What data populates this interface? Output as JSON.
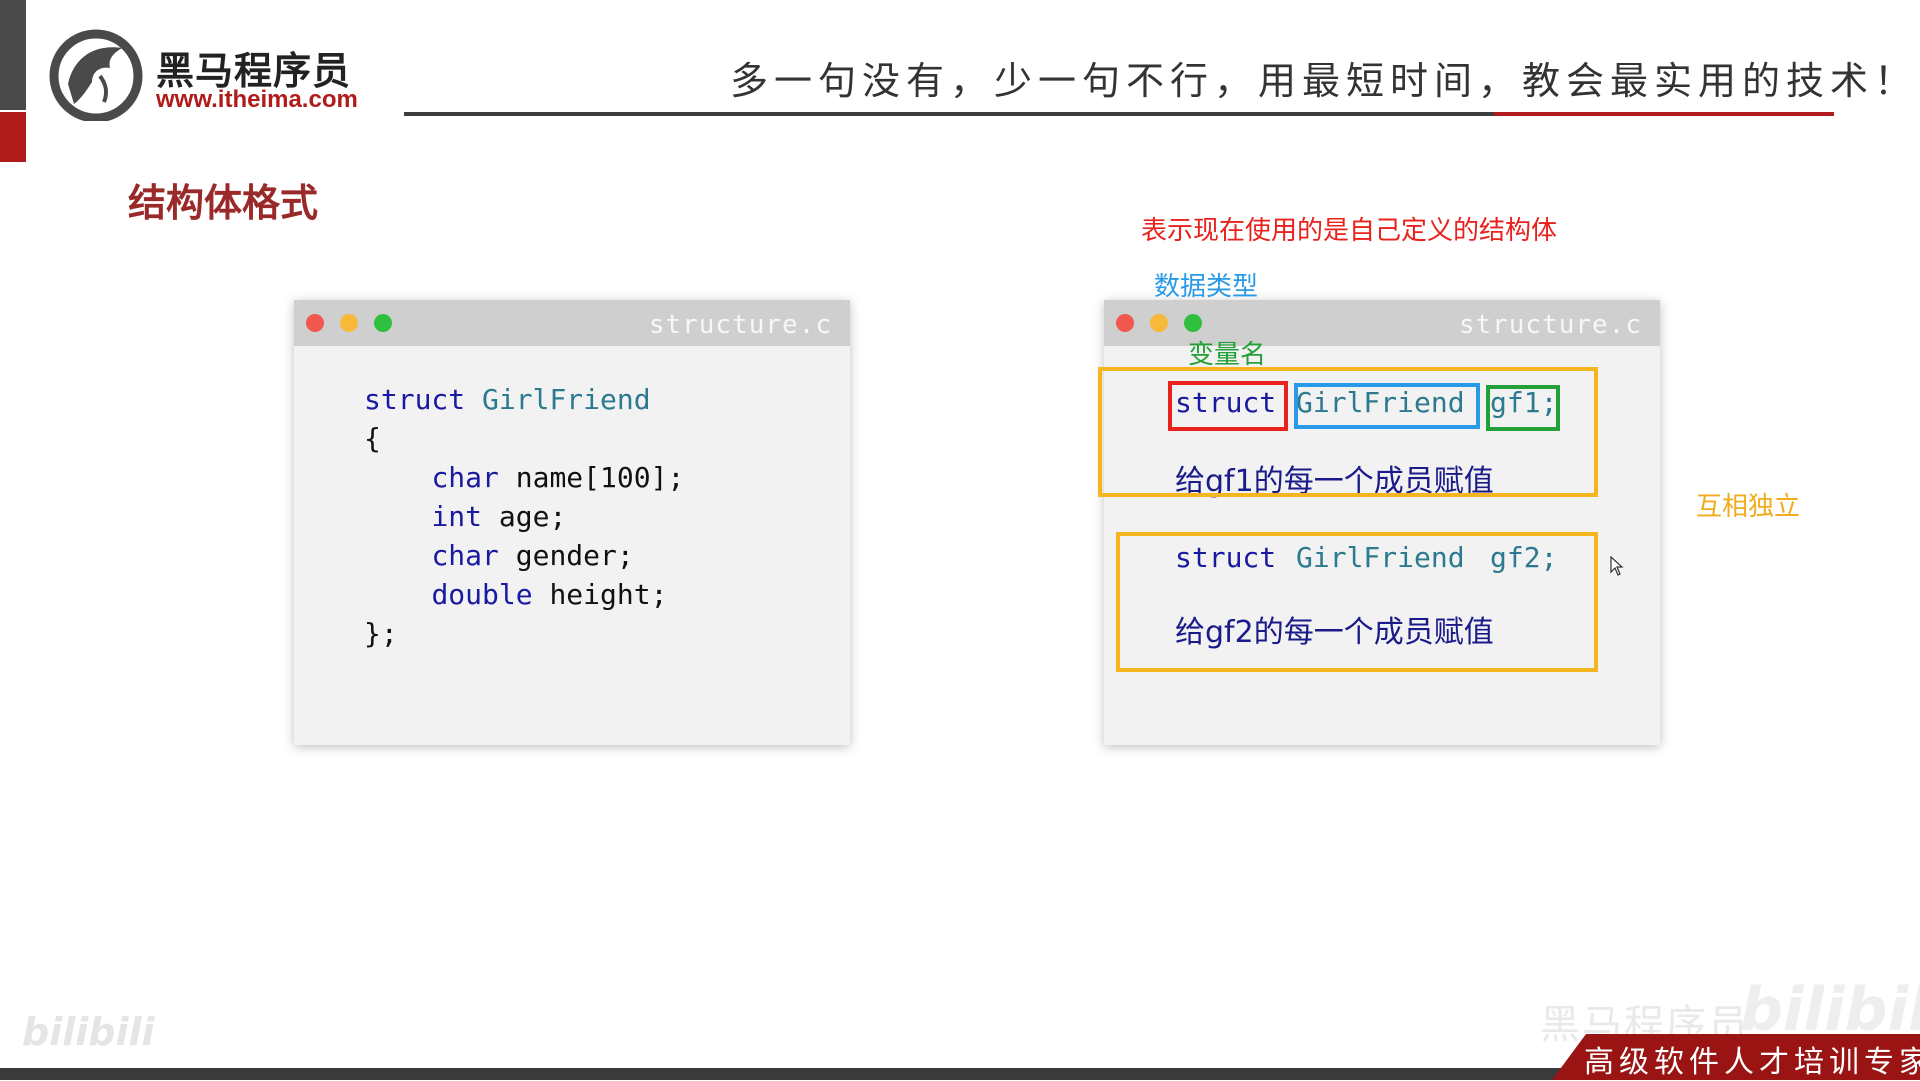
{
  "logo": {
    "name": "黑马程序员",
    "url": "www.itheima.com"
  },
  "slogan": "多一句没有，少一句不行，用最短时间，教会最实用的技术！",
  "section_title": "结构体格式",
  "left_window": {
    "filename": "structure.c",
    "code": {
      "line1_kw": "struct",
      "line1_type": "GirlFriend",
      "line2": "{",
      "line3_kw": "char",
      "line3_rest": " name[100];",
      "line4_kw": "int",
      "line4_rest": " age;",
      "line5_kw": "char",
      "line5_rest": " gender;",
      "line6_kw": "double",
      "line6_rest": " height;",
      "line7": "};"
    }
  },
  "right_window": {
    "filename": "structure.c",
    "row1": {
      "kw": "struct",
      "type": "GirlFriend",
      "var": "gf1;"
    },
    "assign1": "给gf1的每一个成员赋值",
    "row2": {
      "kw": "struct",
      "type": "GirlFriend",
      "var": "gf2;"
    },
    "assign2": "给gf2的每一个成员赋值"
  },
  "annotations": {
    "self_defined": "表示现在使用的是自己定义的结构体",
    "data_type": "数据类型",
    "var_name": "变量名",
    "independent": "互相独立"
  },
  "watermark": {
    "left": "bilibili",
    "right_text": "黑马程序员",
    "right_logo": "bilibili"
  },
  "footer": {
    "text": "高级软件人才培训专家"
  },
  "colors": {
    "brand_red": "#b01c1c",
    "anno_red": "#e8221c",
    "anno_blue": "#2a9ae8",
    "anno_green": "#23a037",
    "anno_orange": "#f0ac1c"
  }
}
